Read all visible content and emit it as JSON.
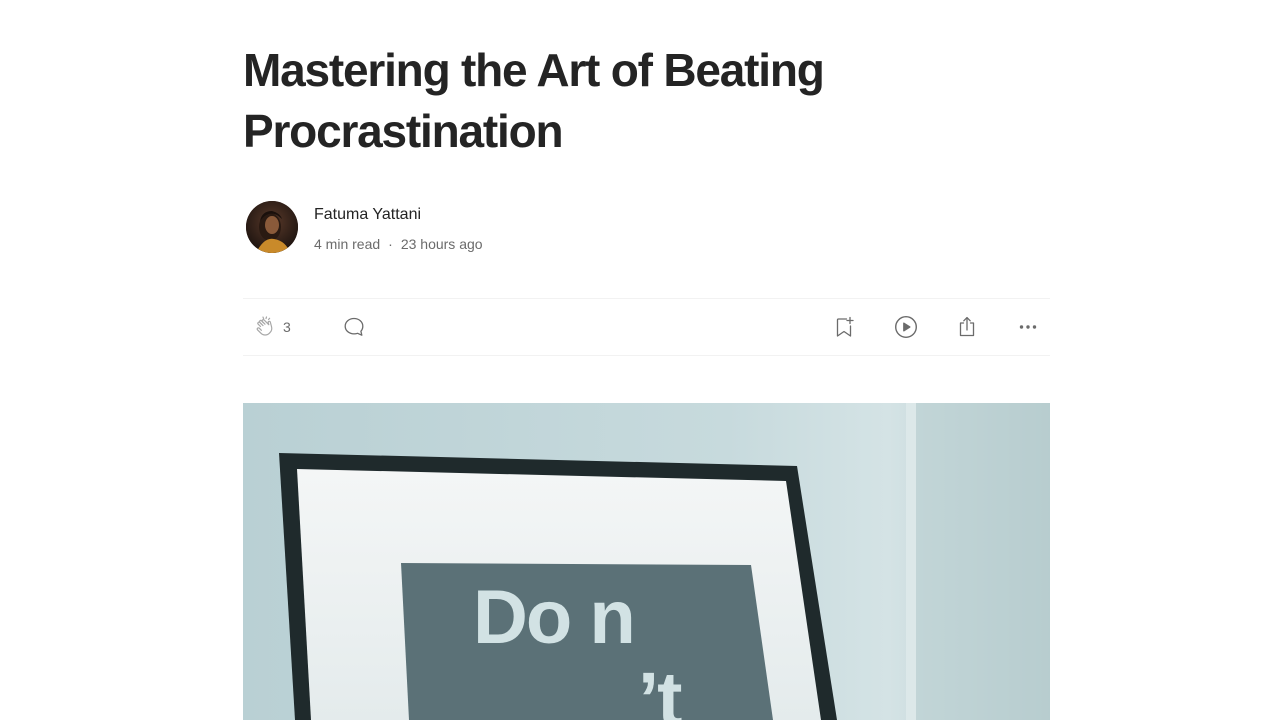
{
  "article": {
    "title": "Mastering the Art of Beating Procrastination",
    "author": "Fatuma Yattani",
    "read_time": "4 min read",
    "separator": "·",
    "published": "23 hours ago"
  },
  "actions": {
    "clap_count": "3",
    "icons": [
      "clap-icon",
      "comment-icon",
      "bookmark-add-icon",
      "listen-play-icon",
      "share-icon",
      "more-icon"
    ]
  },
  "hero_image": {
    "sign_text_line1": "Do n",
    "sign_text_line2": "’t"
  },
  "colors": {
    "text_primary": "#242424",
    "text_secondary": "#6b6b6b",
    "divider": "#f2f2f2"
  }
}
